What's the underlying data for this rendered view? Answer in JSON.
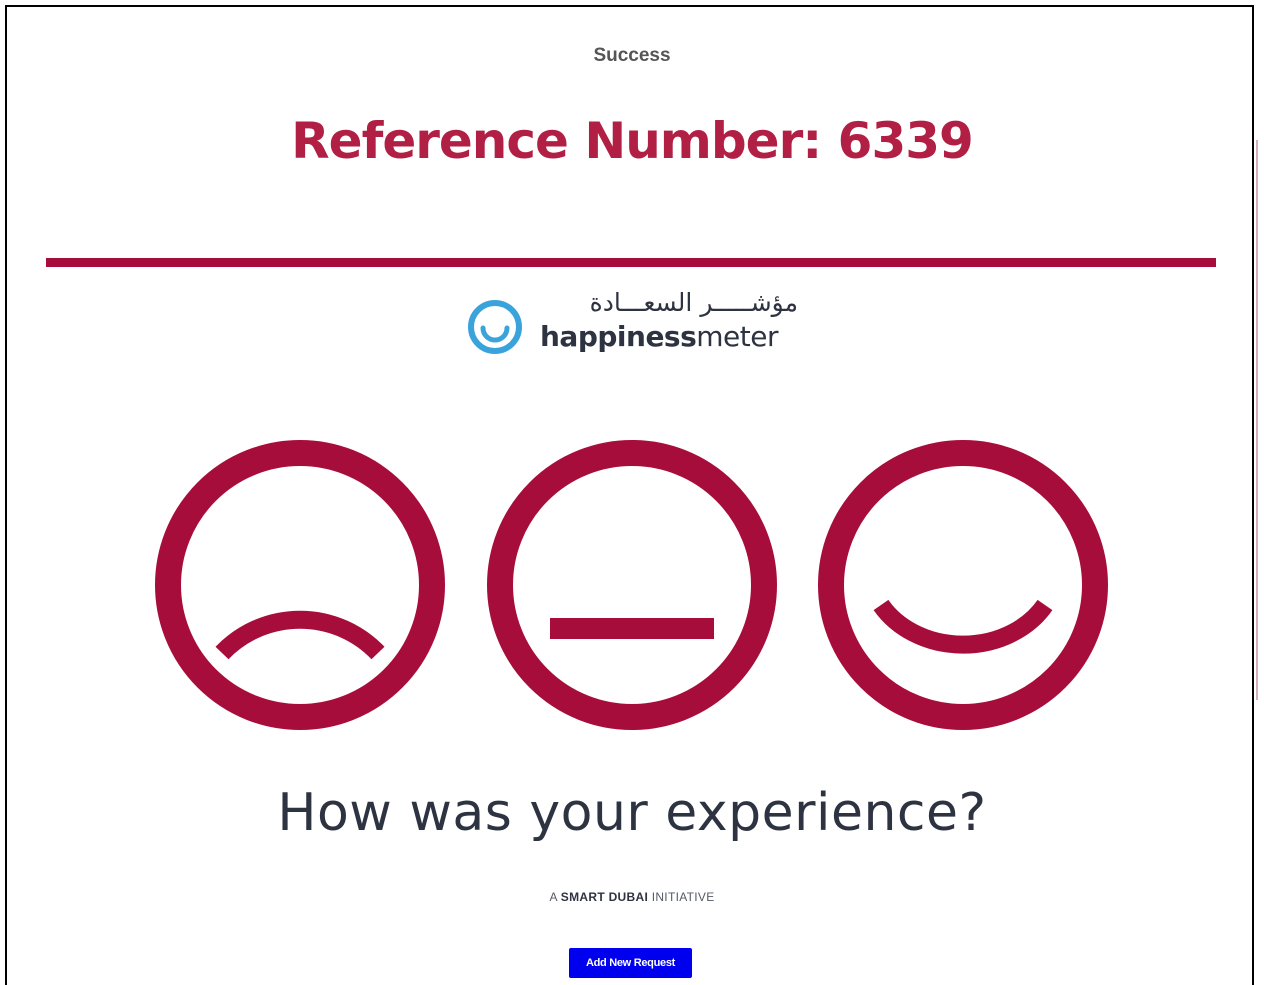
{
  "status": {
    "label": "Success"
  },
  "reference": {
    "text": "Reference Number: 6339"
  },
  "happiness_meter": {
    "arabic_text": "مؤشـــــر السعـــادة",
    "wordmark_bold": "happiness",
    "wordmark_light": "meter",
    "icon": "smile-icon",
    "icon_color": "#3aa3dc"
  },
  "faces": {
    "color": "#a70d3b",
    "items": [
      {
        "name": "sad-face-icon",
        "mood": "unhappy"
      },
      {
        "name": "neutral-face-icon",
        "mood": "neutral"
      },
      {
        "name": "happy-face-icon",
        "mood": "happy"
      }
    ]
  },
  "question": {
    "text": "How was your experience?"
  },
  "initiative": {
    "prefix": "A ",
    "brand": "SMART DUBAI",
    "suffix": " INITIATIVE"
  },
  "actions": {
    "add_new_request_label": "Add New Request",
    "button_color": "#0000ee"
  },
  "colors": {
    "accent": "#a70d3b",
    "reference_text": "#b21f45",
    "heading_text": "#2d3340",
    "status_text": "#555555"
  }
}
